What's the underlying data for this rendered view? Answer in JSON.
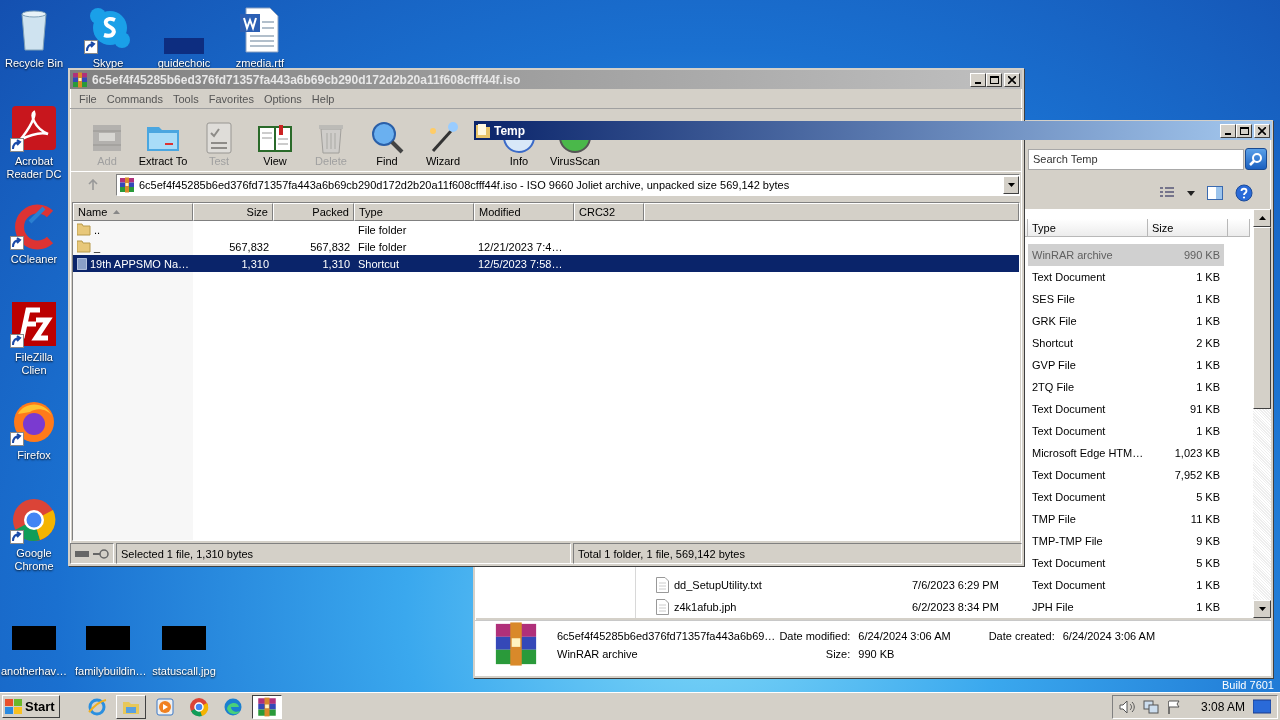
{
  "desktop": {
    "icons": [
      {
        "label": "Recycle Bin",
        "kind": "recycle",
        "shortcut": false
      },
      {
        "label": "Skype",
        "kind": "skype",
        "shortcut": true
      },
      {
        "label": "guidechoic",
        "kind": "blank",
        "shortcut": false
      },
      {
        "label": "zmedia.rtf",
        "kind": "word",
        "shortcut": false
      },
      {
        "label": "Acrobat Reader DC",
        "kind": "acrobat",
        "shortcut": true
      },
      {
        "label": "CCleaner",
        "kind": "ccleaner",
        "shortcut": true
      },
      {
        "label": "FileZilla Clien",
        "kind": "filezilla",
        "shortcut": true
      },
      {
        "label": "Firefox",
        "kind": "firefox",
        "shortcut": true
      },
      {
        "label": "Google Chrome",
        "kind": "chrome",
        "shortcut": true
      },
      {
        "label": "anotherhav…",
        "kind": "thumb",
        "shortcut": false
      },
      {
        "label": "familybuildin…",
        "kind": "thumb",
        "shortcut": false
      },
      {
        "label": "statuscall.jpg",
        "kind": "thumb",
        "shortcut": false
      }
    ],
    "build": "Build 7601"
  },
  "winrar": {
    "title": "6c5ef4f45285b6ed376fd71357fa443a6b69cb290d172d2b20a11f608cfff44f.iso",
    "menu": [
      "File",
      "Commands",
      "Tools",
      "Favorites",
      "Options",
      "Help"
    ],
    "toolbar": [
      {
        "label": "Add",
        "kind": "add",
        "disabled": true
      },
      {
        "label": "Extract To",
        "kind": "extract",
        "disabled": false
      },
      {
        "label": "Test",
        "kind": "test",
        "disabled": true
      },
      {
        "label": "View",
        "kind": "view",
        "disabled": false
      },
      {
        "label": "Delete",
        "kind": "delete",
        "disabled": true
      },
      {
        "label": "Find",
        "kind": "find",
        "disabled": false
      },
      {
        "label": "Wizard",
        "kind": "wizard",
        "disabled": false
      },
      {
        "label": "Info",
        "kind": "info",
        "disabled": false
      },
      {
        "label": "VirusScan",
        "kind": "virus",
        "disabled": false
      }
    ],
    "address": "6c5ef4f45285b6ed376fd71357fa443a6b69cb290d172d2b20a11f608cfff44f.iso - ISO 9660 Joliet archive, unpacked size 569,142 bytes",
    "columns": [
      "Name",
      "Size",
      "Packed",
      "Type",
      "Modified",
      "CRC32"
    ],
    "rows": [
      {
        "kind": "folder",
        "name": "..",
        "size": "",
        "packed": "",
        "type": "File folder",
        "modified": "",
        "selected": false
      },
      {
        "kind": "folder",
        "name": "_",
        "size": "567,832",
        "packed": "567,832",
        "type": "File folder",
        "modified": "12/21/2023 7:4…",
        "selected": false
      },
      {
        "kind": "shortcut",
        "name": "19th APPSMO Na…",
        "size": "1,310",
        "packed": "1,310",
        "type": "Shortcut",
        "modified": "12/5/2023 7:58…",
        "selected": true
      }
    ],
    "status_left": "Selected 1 file, 1,310 bytes",
    "status_right": "Total 1 folder, 1 file, 569,142 bytes"
  },
  "explorer": {
    "title": "Temp",
    "search": {
      "placeholder": "Search Temp"
    },
    "columns": [
      "Type",
      "Size"
    ],
    "rows": [
      {
        "type": "WinRAR archive",
        "size": "990 KB",
        "selected": true
      },
      {
        "type": "Text Document",
        "size": "1 KB",
        "selected": false
      },
      {
        "type": "SES File",
        "size": "1 KB",
        "selected": false
      },
      {
        "type": "GRK File",
        "size": "1 KB",
        "selected": false
      },
      {
        "type": "Shortcut",
        "size": "2 KB",
        "selected": false
      },
      {
        "type": "GVP File",
        "size": "1 KB",
        "selected": false
      },
      {
        "type": "2TQ File",
        "size": "1 KB",
        "selected": false
      },
      {
        "type": "Text Document",
        "size": "91 KB",
        "selected": false
      },
      {
        "type": "Text Document",
        "size": "1 KB",
        "selected": false
      },
      {
        "type": "Microsoft Edge HTM…",
        "size": "1,023 KB",
        "selected": false
      },
      {
        "type": "Text Document",
        "size": "7,952 KB",
        "selected": false
      },
      {
        "type": "Text Document",
        "size": "5 KB",
        "selected": false
      },
      {
        "type": "TMP File",
        "size": "11 KB",
        "selected": false
      },
      {
        "type": "TMP-TMP File",
        "size": "9 KB",
        "selected": false
      },
      {
        "type": "Text Document",
        "size": "5 KB",
        "selected": false
      },
      {
        "name": "dd_SetupUtility.txt",
        "date": "7/6/2023 6:29 PM",
        "type": "Text Document",
        "size": "1 KB",
        "selected": false
      },
      {
        "name": "z4k1afub.jph",
        "date": "6/2/2023 8:34 PM",
        "type": "JPH File",
        "size": "1 KB",
        "selected": false
      }
    ],
    "details": {
      "name": "6c5ef4f45285b6ed376fd71357fa443a6b69…",
      "type": "WinRAR archive",
      "fields": [
        {
          "label": "Date modified:",
          "value": "6/24/2024 3:06 AM"
        },
        {
          "label": "Size:",
          "value": "990 KB"
        },
        {
          "label": "Date created:",
          "value": "6/24/2024 3:06 AM"
        }
      ]
    }
  },
  "taskbar": {
    "start": "Start",
    "apps": [
      {
        "kind": "ie",
        "open": false,
        "selected": false
      },
      {
        "kind": "folder",
        "open": true,
        "selected": false
      },
      {
        "kind": "media",
        "open": false,
        "selected": false
      },
      {
        "kind": "chrome",
        "open": false,
        "selected": false
      },
      {
        "kind": "edge",
        "open": false,
        "selected": false
      },
      {
        "kind": "winrar",
        "open": true,
        "selected": true
      }
    ],
    "clock": "3:08 AM"
  }
}
